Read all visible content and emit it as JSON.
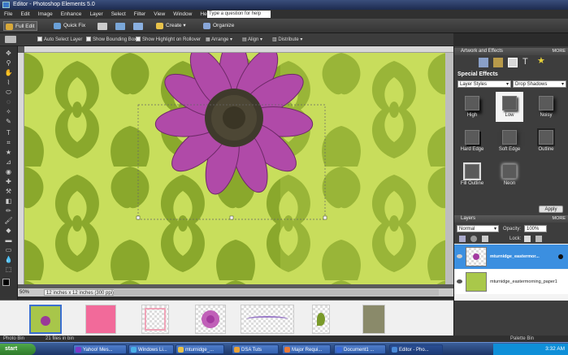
{
  "window": {
    "title": "Editor - Photoshop Elements 5.0"
  },
  "menu": [
    "File",
    "Edit",
    "Image",
    "Enhance",
    "Layer",
    "Select",
    "Filter",
    "View",
    "Window",
    "Help"
  ],
  "help_search": {
    "placeholder": "Type a question for help"
  },
  "modes": {
    "full_edit": "Full Edit",
    "quick_fix": "Quick Fix"
  },
  "toolbar": {
    "create": "Create",
    "organize": "Organize"
  },
  "options": {
    "auto_select": "Auto Select Layer",
    "show_bounding": "Show Bounding Box",
    "show_highlight": "Show Highlight on Rollover",
    "arrange": "Arrange",
    "align": "Align",
    "distribute": "Distribute"
  },
  "status": {
    "zoom": "50%",
    "doc_info": "12 inches x 12 inches (300 ppi)"
  },
  "bin": {
    "label": "Photo Bin",
    "files": "21 files in bin",
    "palette": "Palette Bin"
  },
  "artwork_panel": {
    "title": "Artwork and Effects",
    "more": "MORE",
    "section": "Special Effects",
    "category": "Layer Styles",
    "style": "Drop Shadows",
    "effects": [
      "High",
      "Low",
      "Noisy",
      "Hard Edge",
      "Soft Edge",
      "Outline",
      "Fill Outline",
      "Neon"
    ],
    "apply": "Apply"
  },
  "layers_panel": {
    "title": "Layers",
    "more": "MORE",
    "blend_mode": "Normal",
    "opacity_label": "Opacity:",
    "opacity_value": "100%",
    "lock_label": "Lock:",
    "layers": [
      {
        "name": "mturnidge_eastermor..."
      },
      {
        "name": "mturnidge_eastermorning_paper1"
      }
    ]
  },
  "taskbar": {
    "start": "start",
    "tasks": [
      "Yahoo! Mes...",
      "Windows Li...",
      "mturnidge_...",
      "DSA Tuts",
      "Major Requi...",
      "Document1 ...",
      "Editor - Pho..."
    ],
    "time": "3:32 AM"
  }
}
